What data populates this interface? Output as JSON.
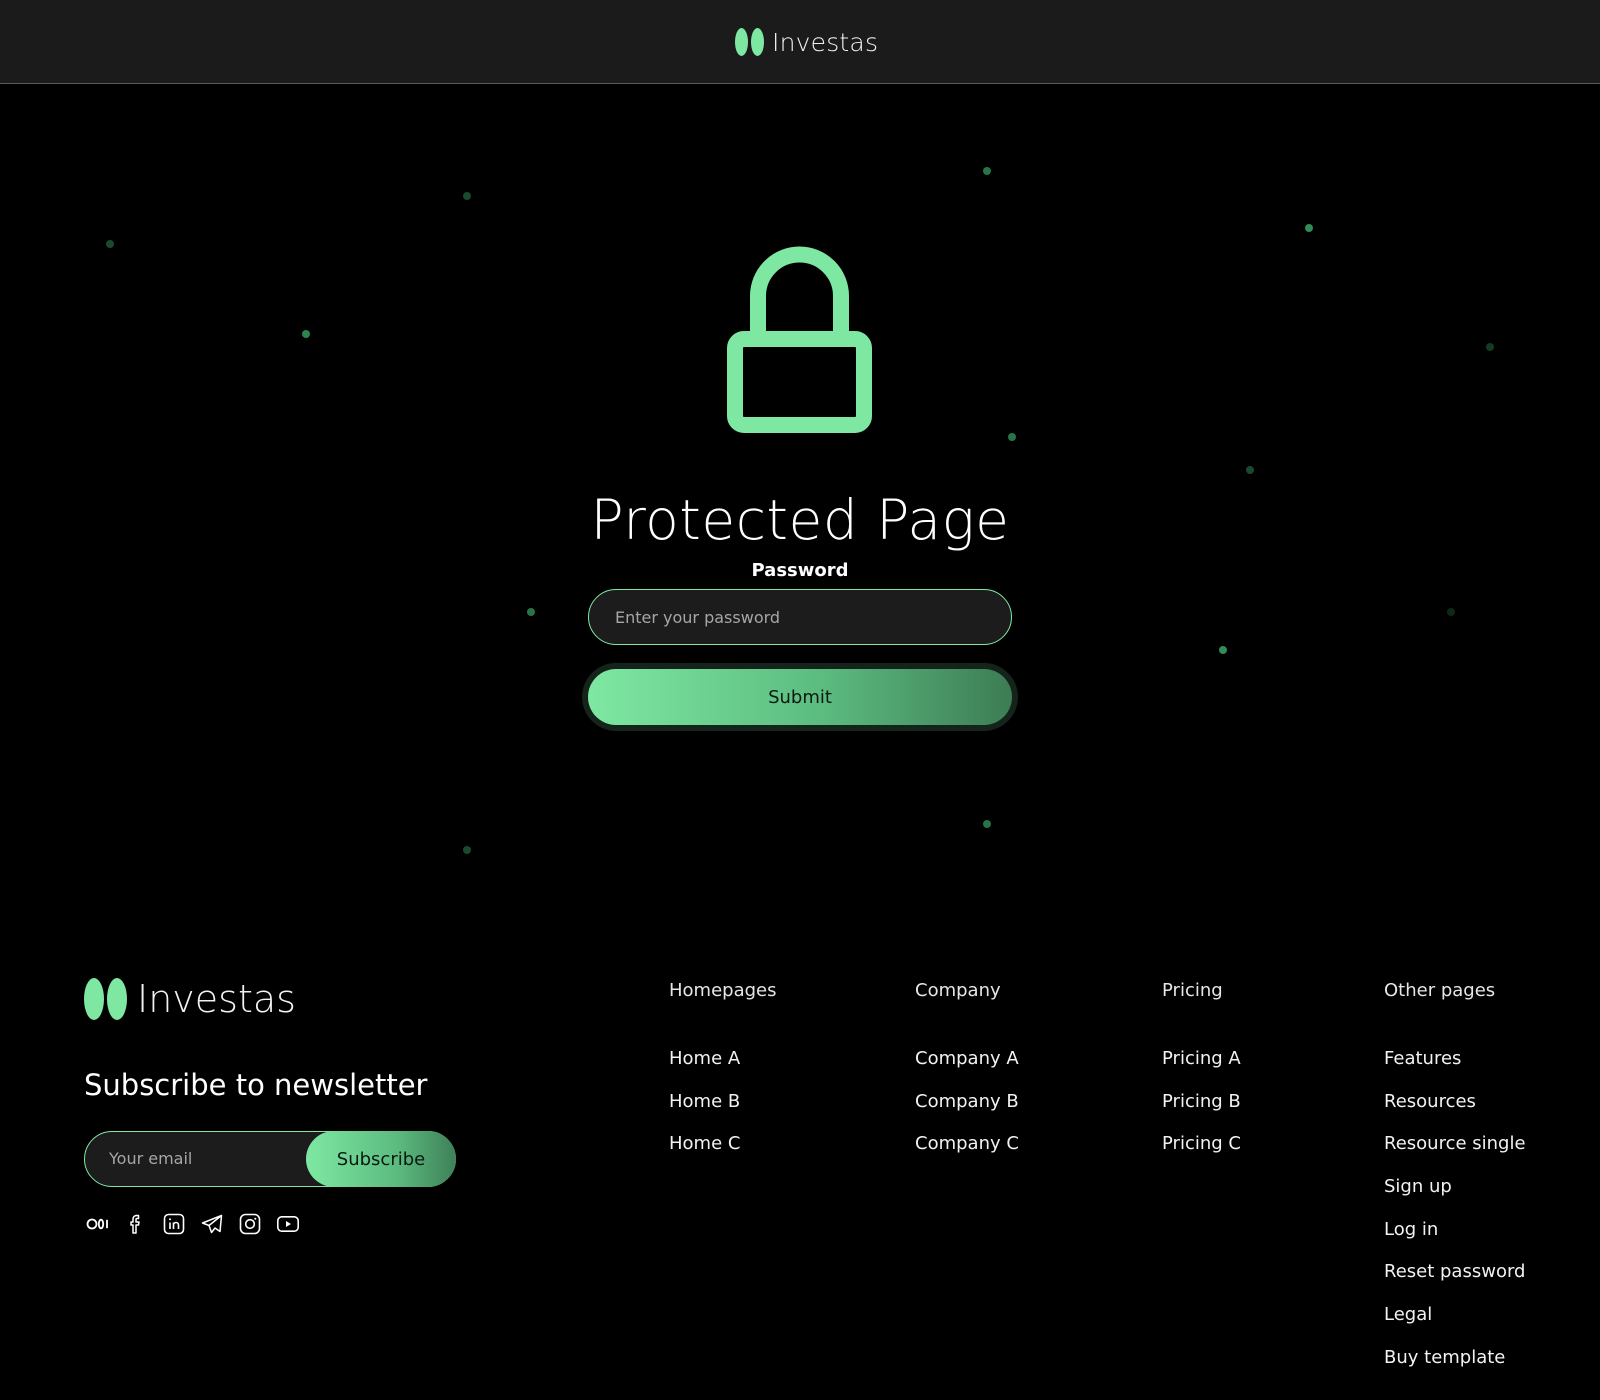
{
  "header": {
    "brand": "Investas"
  },
  "main": {
    "title": "Protected Page",
    "password_label": "Password",
    "password_placeholder": "Enter your password",
    "password_value": "",
    "submit_label": "Submit"
  },
  "footer": {
    "brand": "Investas",
    "newsletter_title": "Subscribe to newsletter",
    "email_placeholder": "Your email",
    "email_value": "",
    "subscribe_label": "Subscribe",
    "socials": [
      "medium-icon",
      "facebook-icon",
      "linkedin-icon",
      "telegram-icon",
      "instagram-icon",
      "youtube-icon"
    ],
    "columns": [
      {
        "heading": "Homepages",
        "links": [
          "Home A",
          "Home B",
          "Home C"
        ]
      },
      {
        "heading": "Company",
        "links": [
          "Company A",
          "Company B",
          "Company C"
        ]
      },
      {
        "heading": "Pricing",
        "links": [
          "Pricing A",
          "Pricing B",
          "Pricing C"
        ]
      },
      {
        "heading": "Other pages",
        "links": [
          "Features",
          "Resources",
          "Resource single",
          "Sign up",
          "Log in",
          "Reset password",
          "Legal",
          "Buy template"
        ]
      }
    ]
  },
  "colors": {
    "accent": "#7ee8a2",
    "background": "#000000",
    "header_bg": "#1b1b1b",
    "field_bg": "#1c1c1c"
  }
}
